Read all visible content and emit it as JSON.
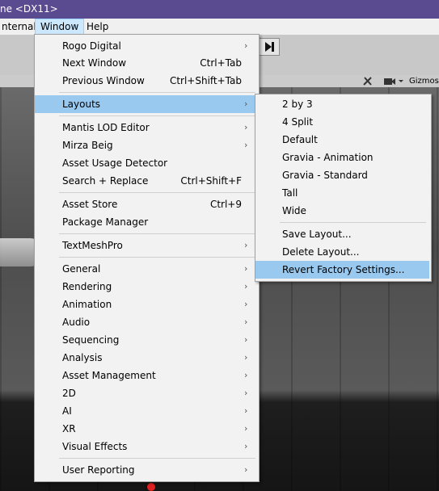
{
  "titlebar": {
    "text": "ne <DX11>"
  },
  "menubar": {
    "items": [
      {
        "label": "nternal"
      },
      {
        "label": "Window"
      },
      {
        "label": "Help"
      }
    ]
  },
  "scene_toolbar": {
    "gizmos_label": "Gizmos"
  },
  "window_menu": {
    "items": [
      {
        "label": "Rogo Digital",
        "submenu": true
      },
      {
        "label": "Next Window",
        "shortcut": "Ctrl+Tab"
      },
      {
        "label": "Previous Window",
        "shortcut": "Ctrl+Shift+Tab"
      },
      {
        "label": "Layouts",
        "submenu": true,
        "highlighted": true
      },
      {
        "label": "Mantis LOD Editor",
        "submenu": true
      },
      {
        "label": "Mirza Beig",
        "submenu": true
      },
      {
        "label": "Asset Usage Detector"
      },
      {
        "label": "Search + Replace",
        "shortcut": "Ctrl+Shift+F"
      },
      {
        "label": "Asset Store",
        "shortcut": "Ctrl+9"
      },
      {
        "label": "Package Manager"
      },
      {
        "label": "TextMeshPro",
        "submenu": true
      },
      {
        "label": "General",
        "submenu": true
      },
      {
        "label": "Rendering",
        "submenu": true
      },
      {
        "label": "Animation",
        "submenu": true
      },
      {
        "label": "Audio",
        "submenu": true
      },
      {
        "label": "Sequencing",
        "submenu": true
      },
      {
        "label": "Analysis",
        "submenu": true
      },
      {
        "label": "Asset Management",
        "submenu": true
      },
      {
        "label": "2D",
        "submenu": true
      },
      {
        "label": "AI",
        "submenu": true
      },
      {
        "label": "XR",
        "submenu": true
      },
      {
        "label": "Visual Effects",
        "submenu": true
      },
      {
        "label": "User Reporting",
        "submenu": true
      }
    ]
  },
  "layouts_menu": {
    "items": [
      {
        "label": "2 by 3"
      },
      {
        "label": "4 Split"
      },
      {
        "label": "Default"
      },
      {
        "label": "Gravia - Animation"
      },
      {
        "label": "Gravia - Standard"
      },
      {
        "label": "Tall"
      },
      {
        "label": "Wide"
      },
      {
        "label": "Save Layout..."
      },
      {
        "label": "Delete Layout..."
      },
      {
        "label": "Revert Factory Settings...",
        "highlighted": true
      }
    ]
  },
  "colors": {
    "titlebar": "#5a4a8f",
    "menu_highlight": "#99c9ef",
    "menubar_active": "#cce8ff"
  },
  "icons": [
    "step-icon",
    "tools-icon",
    "camera-icon",
    "dropdown-arrow-icon",
    "submenu-arrow-icon"
  ]
}
